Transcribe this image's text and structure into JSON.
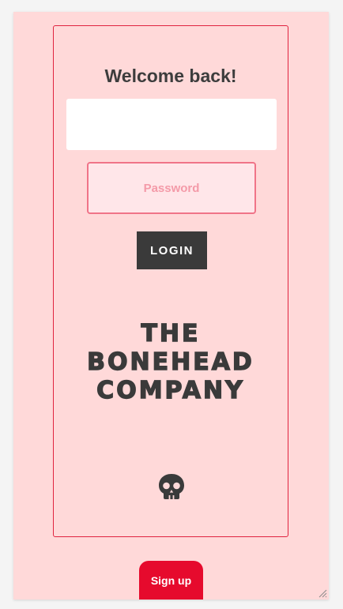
{
  "login": {
    "heading": "Welcome back!",
    "username_value": "",
    "password_placeholder": "Password",
    "login_label": "LOGIN"
  },
  "brand": {
    "line1": "THE",
    "line2": "BONEHEAD",
    "line3": "COMPANY",
    "icon": "skull-icon"
  },
  "footer": {
    "signup_label": "Sign up"
  },
  "colors": {
    "page_background": "#ffd9d9",
    "accent": "#e60a2d",
    "card_border": "#e0233f",
    "dark": "#3a3a3a",
    "password_border": "#f07488",
    "password_fill": "#ffe6e9"
  }
}
